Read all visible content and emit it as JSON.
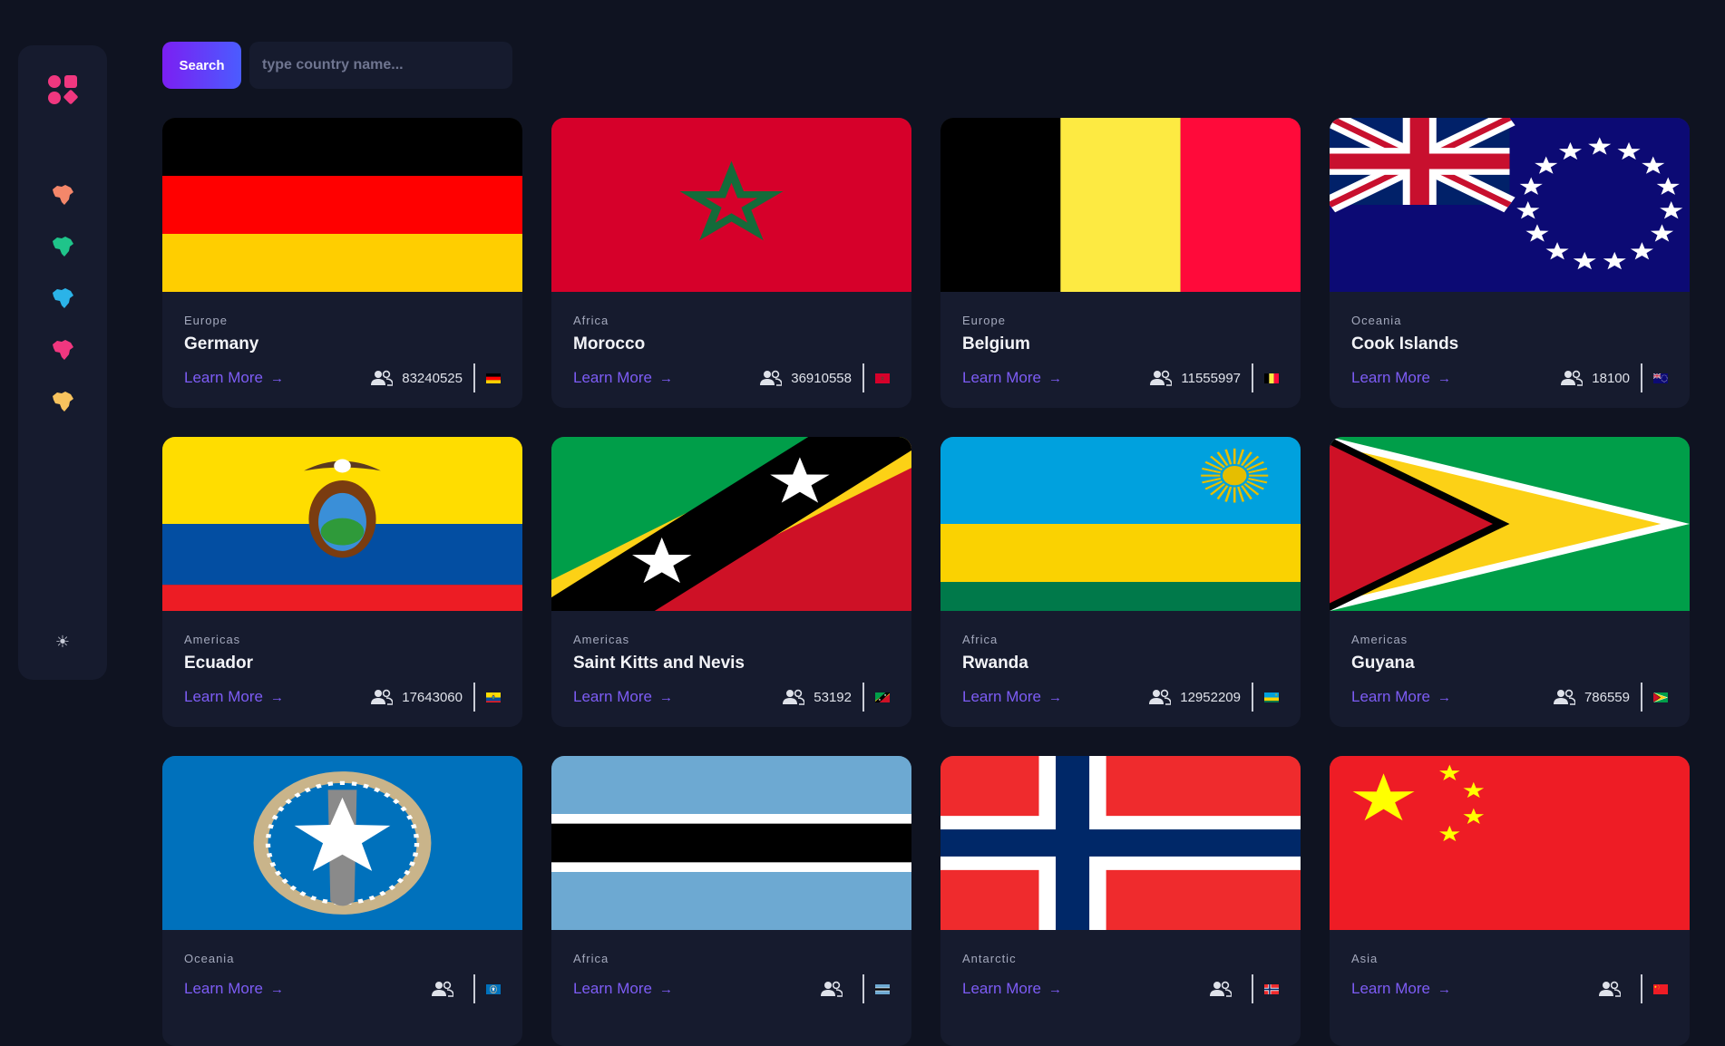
{
  "sidebar": {
    "logo_icon": "app-logo-icon",
    "items": [
      {
        "icon": "continent-map-icon",
        "color": "#f4876a"
      },
      {
        "icon": "continent-map-icon",
        "color": "#1fc48a"
      },
      {
        "icon": "continent-map-icon",
        "color": "#2bb3e8"
      },
      {
        "icon": "continent-map-icon",
        "color": "#f0377f"
      },
      {
        "icon": "continent-map-icon",
        "color": "#f7c35e"
      }
    ],
    "theme_toggle": "☀"
  },
  "search": {
    "button_label": "Search",
    "placeholder": "type country name...",
    "value": ""
  },
  "learn_more_label": "Learn More",
  "colors": {
    "accent": "#7d5cf5",
    "background": "#0f1321",
    "card": "#161b2e"
  },
  "countries": [
    {
      "region": "Europe",
      "name": "Germany",
      "population": "83240525",
      "flag": "germany"
    },
    {
      "region": "Africa",
      "name": "Morocco",
      "population": "36910558",
      "flag": "morocco"
    },
    {
      "region": "Europe",
      "name": "Belgium",
      "population": "11555997",
      "flag": "belgium"
    },
    {
      "region": "Oceania",
      "name": "Cook Islands",
      "population": "18100",
      "flag": "cook-islands"
    },
    {
      "region": "Americas",
      "name": "Ecuador",
      "population": "17643060",
      "flag": "ecuador"
    },
    {
      "region": "Americas",
      "name": "Saint Kitts and Nevis",
      "population": "53192",
      "flag": "saint-kitts-and-nevis"
    },
    {
      "region": "Africa",
      "name": "Rwanda",
      "population": "12952209",
      "flag": "rwanda"
    },
    {
      "region": "Americas",
      "name": "Guyana",
      "population": "786559",
      "flag": "guyana"
    },
    {
      "region": "Oceania",
      "name": "",
      "population": "",
      "flag": "northern-mariana-islands"
    },
    {
      "region": "Africa",
      "name": "",
      "population": "",
      "flag": "botswana"
    },
    {
      "region": "Antarctic",
      "name": "",
      "population": "",
      "flag": "bouvet-island"
    },
    {
      "region": "Asia",
      "name": "",
      "population": "",
      "flag": "china"
    }
  ]
}
